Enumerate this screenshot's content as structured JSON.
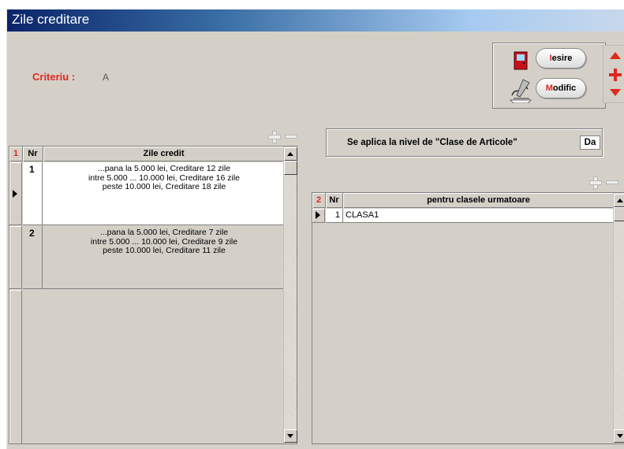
{
  "window": {
    "title": "Zile creditare"
  },
  "criteriu": {
    "label": "Criteriu :",
    "value": "A"
  },
  "buttons": {
    "iesire": {
      "hot": "I",
      "rest": "esire"
    },
    "modific": {
      "hot": "M",
      "rest": "odific"
    }
  },
  "icons": {
    "exit": "door-icon",
    "edit": "signature-icon",
    "nav_up": "arrow-up-icon",
    "nav_add": "plus-icon",
    "nav_down": "arrow-down-icon",
    "grid_add": "plus-icon",
    "grid_remove": "minus-icon"
  },
  "colors": {
    "accent": "#e0281e",
    "title_start": "#0a246a",
    "face": "#d4d0c8"
  },
  "grid1": {
    "number": "1",
    "headers": {
      "nr": "Nr",
      "zile": "Zile credit"
    },
    "rows": [
      {
        "nr": "1",
        "lines": [
          "...pana la 5.000 lei,  Creditare 12 zile",
          "intre 5.000 ... 10.000 lei,  Creditare 16 zile",
          "peste 10.000 lei,  Creditare 18 zile"
        ]
      },
      {
        "nr": "2",
        "lines": [
          "...pana la 5.000 lei,  Creditare 7 zile",
          "intre 5.000 ... 10.000 lei,  Creditare 9 zile",
          "peste 10.000 lei,  Creditare 11 zile"
        ]
      }
    ]
  },
  "aplica": {
    "label": "Se aplica la nivel de  \"Clase de Articole\"",
    "value": "Da"
  },
  "grid2": {
    "number": "2",
    "headers": {
      "nr": "Nr",
      "clase": "pentru clasele urmatoare"
    },
    "rows": [
      {
        "nr": "1",
        "clasa": "CLASA1"
      }
    ]
  }
}
